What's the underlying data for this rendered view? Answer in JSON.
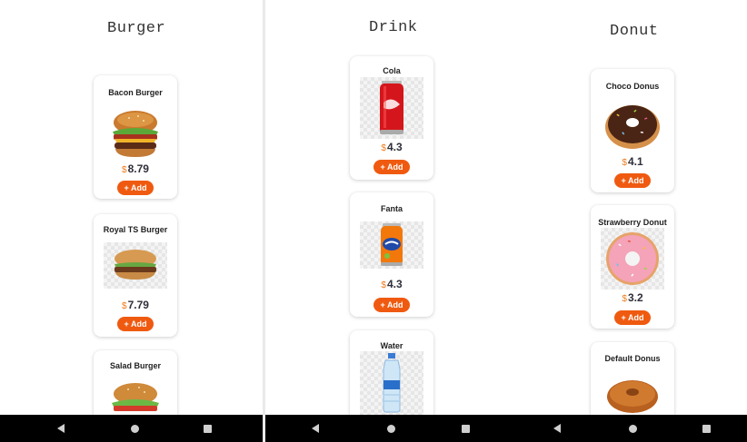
{
  "burger_screen": {
    "header": "Burger",
    "items": [
      {
        "name": "Bacon Burger",
        "currency": "$",
        "price": "8.79",
        "add_label": "+ Add"
      },
      {
        "name": "Royal TS Burger",
        "currency": "$",
        "price": "7.79",
        "add_label": "+ Add"
      },
      {
        "name": "Salad Burger"
      }
    ]
  },
  "drink_column": {
    "header": "Drink",
    "items": [
      {
        "name": "Cola",
        "currency": "$",
        "price": "4.3",
        "add_label": "+ Add"
      },
      {
        "name": "Fanta",
        "currency": "$",
        "price": "4.3",
        "add_label": "+ Add"
      },
      {
        "name": "Water"
      }
    ]
  },
  "donut_column": {
    "header": "Donut",
    "items": [
      {
        "name": "Choco Donus",
        "currency": "$",
        "price": "4.1",
        "add_label": "+ Add"
      },
      {
        "name": "Strawberry Donut",
        "currency": "$",
        "price": "3.2",
        "add_label": "+ Add"
      },
      {
        "name": "Default Donus"
      }
    ]
  },
  "navbar": {
    "buttons": [
      "back",
      "home",
      "recents"
    ]
  },
  "colors": {
    "accent": "#ef5a10",
    "currency": "#f07a1a",
    "navbar": "#000000"
  }
}
